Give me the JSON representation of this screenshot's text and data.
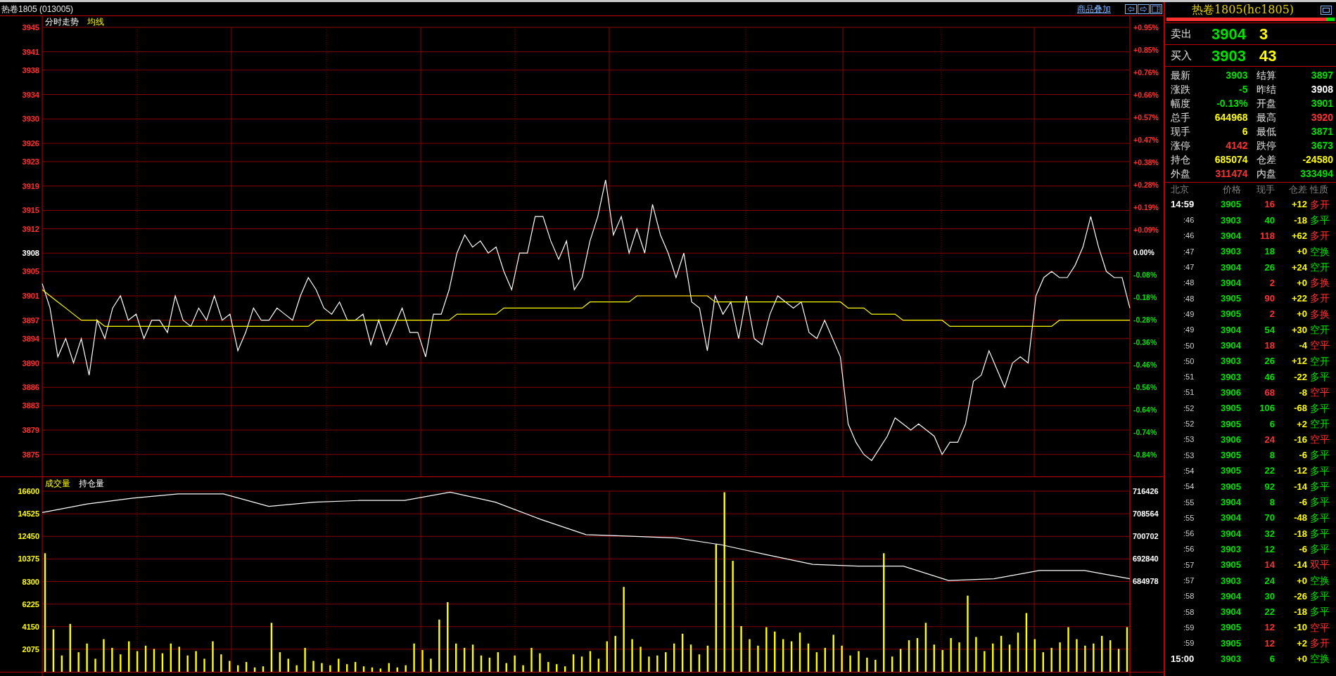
{
  "header": {
    "title": "热卷1805 (013005)",
    "overlay_link": "商品叠加"
  },
  "price_pane": {
    "right_axis": [
      {
        "label": "+0.95%",
        "color": "#ff3232"
      },
      {
        "label": "+0.85%",
        "color": "#ff3232"
      },
      {
        "label": "+0.76%",
        "color": "#ff3232"
      },
      {
        "label": "+0.66%",
        "color": "#ff3232"
      },
      {
        "label": "+0.57%",
        "color": "#ff3232"
      },
      {
        "label": "+0.47%",
        "color": "#ff3232"
      },
      {
        "label": "+0.38%",
        "color": "#ff3232"
      },
      {
        "label": "+0.28%",
        "color": "#ff3232"
      },
      {
        "label": "+0.19%",
        "color": "#ff3232"
      },
      {
        "label": "+0.09%",
        "color": "#ff3232"
      },
      {
        "label": "0.00%",
        "color": "#ffffff"
      },
      {
        "label": "-0.08%",
        "color": "#00e000"
      },
      {
        "label": "-0.18%",
        "color": "#00e000"
      },
      {
        "label": "-0.28%",
        "color": "#00e000"
      },
      {
        "label": "-0.36%",
        "color": "#00e000"
      },
      {
        "label": "-0.46%",
        "color": "#00e000"
      },
      {
        "label": "-0.56%",
        "color": "#00e000"
      },
      {
        "label": "-0.64%",
        "color": "#00e000"
      },
      {
        "label": "-0.74%",
        "color": "#00e000"
      },
      {
        "label": "-0.84%",
        "color": "#00e000"
      }
    ],
    "baseline": "3908",
    "chart_data": {
      "type": "line",
      "grid": true,
      "ylim": [
        3871.4,
        3945
      ],
      "yticks": [
        3945,
        3941,
        3938,
        3934,
        3930,
        3926,
        3923,
        3919,
        3915,
        3912,
        3908,
        3905,
        3901,
        3897,
        3894,
        3890,
        3886,
        3883,
        3879,
        3875
      ],
      "series": [
        {
          "name": "分时走势",
          "color": "#ffffff",
          "values": [
            3903,
            3899,
            3891,
            3894,
            3890,
            3894,
            3888,
            3897,
            3894,
            3899,
            3901,
            3897,
            3898,
            3894,
            3897,
            3897,
            3895,
            3901,
            3897,
            3896,
            3899,
            3897,
            3901,
            3897,
            3898,
            3892,
            3895,
            3899,
            3897,
            3897,
            3899,
            3898,
            3897,
            3901,
            3904,
            3902,
            3899,
            3898,
            3900,
            3897,
            3897,
            3898,
            3893,
            3897,
            3893,
            3896,
            3899,
            3895,
            3895,
            3891,
            3898,
            3898,
            3902,
            3908,
            3911,
            3909,
            3910,
            3908,
            3909,
            3905,
            3902,
            3908,
            3908,
            3914,
            3914,
            3910,
            3907,
            3910,
            3902,
            3904,
            3910,
            3914,
            3920,
            3911,
            3914,
            3908,
            3912,
            3908,
            3916,
            3911,
            3908,
            3904,
            3908,
            3900,
            3899,
            3892,
            3901,
            3898,
            3900,
            3894,
            3901,
            3894,
            3893,
            3898,
            3901,
            3900,
            3899,
            3900,
            3895,
            3894,
            3897,
            3894,
            3891,
            3880,
            3877,
            3875,
            3874,
            3876,
            3878,
            3881,
            3880,
            3879,
            3880,
            3879,
            3878,
            3875,
            3877,
            3877,
            3880,
            3887,
            3888,
            3892,
            3889,
            3886,
            3890,
            3891,
            3890,
            3901,
            3904,
            3905,
            3904,
            3904,
            3906,
            3909,
            3914,
            3909,
            3905,
            3904,
            3904,
            3899
          ]
        },
        {
          "name": "均线",
          "color": "#ffff00",
          "values": [
            3902,
            3901,
            3900,
            3899,
            3898,
            3897,
            3897,
            3897,
            3896,
            3896,
            3896,
            3896,
            3896,
            3896,
            3896,
            3896,
            3896,
            3896,
            3896,
            3896,
            3896,
            3896,
            3896,
            3896,
            3896,
            3896,
            3896,
            3896,
            3896,
            3896,
            3896,
            3896,
            3896,
            3896,
            3896,
            3897,
            3897,
            3897,
            3897,
            3897,
            3897,
            3897,
            3897,
            3897,
            3897,
            3897,
            3897,
            3897,
            3897,
            3897,
            3897,
            3897,
            3897,
            3898,
            3898,
            3898,
            3898,
            3898,
            3898,
            3899,
            3899,
            3899,
            3899,
            3899,
            3899,
            3899,
            3899,
            3899,
            3899,
            3899,
            3900,
            3900,
            3900,
            3900,
            3900,
            3900,
            3901,
            3901,
            3901,
            3901,
            3901,
            3901,
            3901,
            3901,
            3901,
            3901,
            3900,
            3900,
            3900,
            3900,
            3900,
            3900,
            3900,
            3900,
            3900,
            3900,
            3900,
            3900,
            3900,
            3900,
            3900,
            3900,
            3900,
            3899,
            3899,
            3899,
            3898,
            3898,
            3898,
            3898,
            3897,
            3897,
            3897,
            3897,
            3897,
            3897,
            3896,
            3896,
            3896,
            3896,
            3896,
            3896,
            3896,
            3896,
            3896,
            3896,
            3896,
            3896,
            3896,
            3896,
            3897,
            3897,
            3897,
            3897,
            3897,
            3897,
            3897,
            3897,
            3897,
            3897
          ]
        }
      ]
    }
  },
  "volume_pane": {
    "volume_chart": {
      "chart_data": {
        "type": "bar",
        "grid": true,
        "ylim": [
          0,
          16600
        ],
        "yticks": [
          16600,
          14525,
          12450,
          10375,
          8300,
          6225,
          4150,
          2075
        ],
        "categories": [
          null,
          null,
          null,
          null,
          null,
          null,
          null,
          null,
          null,
          null,
          null,
          null,
          null,
          null,
          null,
          null,
          null,
          null,
          null,
          null,
          null,
          null,
          null,
          null,
          null,
          null,
          null,
          null,
          null,
          null,
          null,
          null,
          null,
          null,
          null,
          null,
          null,
          null,
          null,
          null,
          null,
          null,
          null,
          null,
          null,
          null,
          null,
          null,
          null,
          null,
          null,
          null,
          null,
          null,
          null,
          null,
          null,
          null,
          null,
          null,
          null,
          null,
          null,
          null,
          null,
          null,
          null,
          null,
          null,
          null,
          null,
          null,
          null,
          null,
          null,
          null,
          null,
          null,
          null,
          null,
          null,
          null,
          null,
          null,
          null,
          null,
          null,
          null,
          null,
          null,
          null,
          null,
          null,
          null,
          null,
          null,
          null,
          null,
          null,
          null,
          null,
          null,
          null,
          null,
          null,
          null,
          null,
          null,
          null,
          null,
          null,
          null,
          null,
          null,
          null,
          null,
          null,
          null,
          null,
          null,
          null,
          null,
          null,
          null,
          null,
          null,
          null,
          null,
          null,
          null
        ],
        "series": [
          {
            "name": "成交量",
            "color": "#ffff00",
            "values": [
              10900,
              3900,
              1500,
              4400,
              1800,
              2600,
              1200,
              3000,
              2200,
              1600,
              2800,
              1900,
              2400,
              2100,
              1700,
              2600,
              2300,
              1500,
              1900,
              1200,
              2800,
              1600,
              1000,
              600,
              900,
              400,
              500,
              4500,
              1800,
              1200,
              600,
              2200,
              1000,
              800,
              600,
              1200,
              700,
              900,
              500,
              400,
              300,
              800,
              400,
              600,
              2600,
              2000,
              1200,
              4800,
              6400,
              2600,
              2200,
              2500,
              1500,
              1300,
              1800,
              800,
              1500,
              600,
              2200,
              1700,
              900,
              700,
              500,
              1600,
              1400,
              1900,
              1200,
              2800,
              3300,
              7800,
              3000,
              2300,
              1400,
              1500,
              1800,
              2600,
              3500,
              2500,
              1600,
              2400,
              11700,
              16500,
              10200,
              4200,
              3000,
              2400,
              4100,
              3700,
              3000,
              2800,
              3600,
              2600,
              1800,
              2200,
              3400,
              2400,
              1500,
              1900,
              1300,
              1100,
              10900,
              1400,
              2100,
              2900,
              3100,
              4500,
              2500,
              2000,
              3100,
              2700,
              7000,
              3200,
              1900,
              2600,
              3300,
              2500,
              3600,
              5400,
              3000,
              1800,
              2200,
              2700,
              4100,
              3000,
              2400,
              2600,
              3300,
              2900,
              2100,
              4100
            ]
          }
        ]
      }
    },
    "open_interest_chart": {
      "chart_data": {
        "type": "line",
        "ylim": [
          653480,
          716426
        ],
        "yticks": [
          716426,
          708564,
          700702,
          692840,
          684978
        ],
        "series": [
          {
            "name": "持仓量",
            "color": "#ffffff",
            "values": [
              709000,
              712000,
              714000,
              715500,
              715500,
              711100,
              712600,
              713200,
              713200,
              716100,
              712600,
              706600,
              701300,
              700700,
              700100,
              697700,
              694200,
              690900,
              690300,
              690300,
              685300,
              685900,
              688800,
              688800,
              685900
            ]
          }
        ]
      }
    }
  },
  "quote": {
    "title": "热卷1805(hc1805)",
    "ratio_bar": {
      "level": 0.95
    },
    "sell": {
      "label": "卖出",
      "price": "3904",
      "volume": "3"
    },
    "buy": {
      "label": "买入",
      "price": "3903",
      "volume": "43"
    },
    "stats": [
      {
        "label": "最新",
        "value": "3903",
        "color": "#00e000"
      },
      {
        "label": "结算",
        "value": "3897",
        "color": "#00e000"
      },
      {
        "label": "涨跌",
        "value": "-5",
        "color": "#00e000"
      },
      {
        "label": "昨结",
        "value": "3908",
        "color": "#ffffff"
      },
      {
        "label": "幅度",
        "value": "-0.13%",
        "color": "#00e000"
      },
      {
        "label": "开盘",
        "value": "3901",
        "color": "#00e000"
      },
      {
        "label": "总手",
        "value": "644968",
        "color": "#ffff00"
      },
      {
        "label": "最高",
        "value": "3920",
        "color": "#ff3232"
      },
      {
        "label": "现手",
        "value": "6",
        "color": "#ffff00"
      },
      {
        "label": "最低",
        "value": "3871",
        "color": "#00e000"
      },
      {
        "label": "涨停",
        "value": "4142",
        "color": "#ff3232"
      },
      {
        "label": "跌停",
        "value": "3673",
        "color": "#00e000"
      },
      {
        "label": "持仓",
        "value": "685074",
        "color": "#ffff00"
      },
      {
        "label": "仓差",
        "value": "-24580",
        "color": "#ffff00"
      },
      {
        "label": "外盘",
        "value": "311474",
        "color": "#ff3232"
      },
      {
        "label": "内盘",
        "value": "333494",
        "color": "#00e000"
      }
    ],
    "trade_columns": [
      "北京",
      "价格",
      "现手",
      "仓差",
      "性质"
    ],
    "trades": [
      {
        "time": "14:59",
        "kind": "full",
        "price": "3905",
        "volume": "16",
        "oi_change": "+12",
        "nature": "多开",
        "color": "#ff3232"
      },
      {
        "time": ":46",
        "kind": "minute",
        "price": "3903",
        "volume": "40",
        "oi_change": "-18",
        "nature": "多平",
        "color": "#00e000"
      },
      {
        "time": ":46",
        "kind": "minute",
        "price": "3904",
        "volume": "118",
        "oi_change": "+62",
        "nature": "多开",
        "color": "#ff3232"
      },
      {
        "time": ":47",
        "kind": "minute",
        "price": "3903",
        "volume": "18",
        "oi_change": "+0",
        "nature": "空换",
        "color": "#00e000"
      },
      {
        "time": ":47",
        "kind": "minute",
        "price": "3904",
        "volume": "26",
        "oi_change": "+24",
        "nature": "空开",
        "color": "#00e000"
      },
      {
        "time": ":48",
        "kind": "minute",
        "price": "3904",
        "volume": "2",
        "oi_change": "+0",
        "nature": "多换",
        "color": "#ff3232"
      },
      {
        "time": ":48",
        "kind": "minute",
        "price": "3905",
        "volume": "90",
        "oi_change": "+22",
        "nature": "多开",
        "color": "#ff3232"
      },
      {
        "time": ":49",
        "kind": "minute",
        "price": "3905",
        "volume": "2",
        "oi_change": "+0",
        "nature": "多换",
        "color": "#ff3232"
      },
      {
        "time": ":49",
        "kind": "minute",
        "price": "3904",
        "volume": "54",
        "oi_change": "+30",
        "nature": "空开",
        "color": "#00e000"
      },
      {
        "time": ":50",
        "kind": "minute",
        "price": "3904",
        "volume": "18",
        "oi_change": "-4",
        "nature": "空平",
        "color": "#ff3232"
      },
      {
        "time": ":50",
        "kind": "minute",
        "price": "3903",
        "volume": "26",
        "oi_change": "+12",
        "nature": "空开",
        "color": "#00e000"
      },
      {
        "time": ":51",
        "kind": "minute",
        "price": "3903",
        "volume": "46",
        "oi_change": "-22",
        "nature": "多平",
        "color": "#00e000"
      },
      {
        "time": ":51",
        "kind": "minute",
        "price": "3906",
        "volume": "68",
        "oi_change": "-8",
        "nature": "空平",
        "color": "#ff3232"
      },
      {
        "time": ":52",
        "kind": "minute",
        "price": "3905",
        "volume": "106",
        "oi_change": "-68",
        "nature": "多平",
        "color": "#00e000"
      },
      {
        "time": ":52",
        "kind": "minute",
        "price": "3905",
        "volume": "6",
        "oi_change": "+2",
        "nature": "空开",
        "color": "#00e000"
      },
      {
        "time": ":53",
        "kind": "minute",
        "price": "3906",
        "volume": "24",
        "oi_change": "-16",
        "nature": "空平",
        "color": "#ff3232"
      },
      {
        "time": ":53",
        "kind": "minute",
        "price": "3905",
        "volume": "8",
        "oi_change": "-6",
        "nature": "多平",
        "color": "#00e000"
      },
      {
        "time": ":54",
        "kind": "minute",
        "price": "3905",
        "volume": "22",
        "oi_change": "-12",
        "nature": "多平",
        "color": "#00e000"
      },
      {
        "time": ":54",
        "kind": "minute",
        "price": "3905",
        "volume": "92",
        "oi_change": "-14",
        "nature": "多平",
        "color": "#00e000"
      },
      {
        "time": ":55",
        "kind": "minute",
        "price": "3904",
        "volume": "8",
        "oi_change": "-6",
        "nature": "多平",
        "color": "#00e000"
      },
      {
        "time": ":55",
        "kind": "minute",
        "price": "3904",
        "volume": "70",
        "oi_change": "-48",
        "nature": "多平",
        "color": "#00e000"
      },
      {
        "time": ":56",
        "kind": "minute",
        "price": "3904",
        "volume": "32",
        "oi_change": "-18",
        "nature": "多平",
        "color": "#00e000"
      },
      {
        "time": ":56",
        "kind": "minute",
        "price": "3903",
        "volume": "12",
        "oi_change": "-6",
        "nature": "多平",
        "color": "#00e000"
      },
      {
        "time": ":57",
        "kind": "minute",
        "price": "3905",
        "volume": "14",
        "oi_change": "-14",
        "nature": "双平",
        "color": "#ff3232"
      },
      {
        "time": ":57",
        "kind": "minute",
        "price": "3903",
        "volume": "24",
        "oi_change": "+0",
        "nature": "空换",
        "color": "#00e000"
      },
      {
        "time": ":58",
        "kind": "minute",
        "price": "3904",
        "volume": "30",
        "oi_change": "-26",
        "nature": "多平",
        "color": "#00e000"
      },
      {
        "time": ":58",
        "kind": "minute",
        "price": "3904",
        "volume": "22",
        "oi_change": "-18",
        "nature": "多平",
        "color": "#00e000"
      },
      {
        "time": ":59",
        "kind": "minute",
        "price": "3905",
        "volume": "12",
        "oi_change": "-10",
        "nature": "空平",
        "color": "#ff3232"
      },
      {
        "time": ":59",
        "kind": "minute",
        "price": "3905",
        "volume": "12",
        "oi_change": "+2",
        "nature": "多开",
        "color": "#ff3232"
      },
      {
        "time": "15:00",
        "kind": "full",
        "price": "3903",
        "volume": "6",
        "oi_change": "+0",
        "nature": "空换",
        "color": "#00e000"
      }
    ]
  }
}
